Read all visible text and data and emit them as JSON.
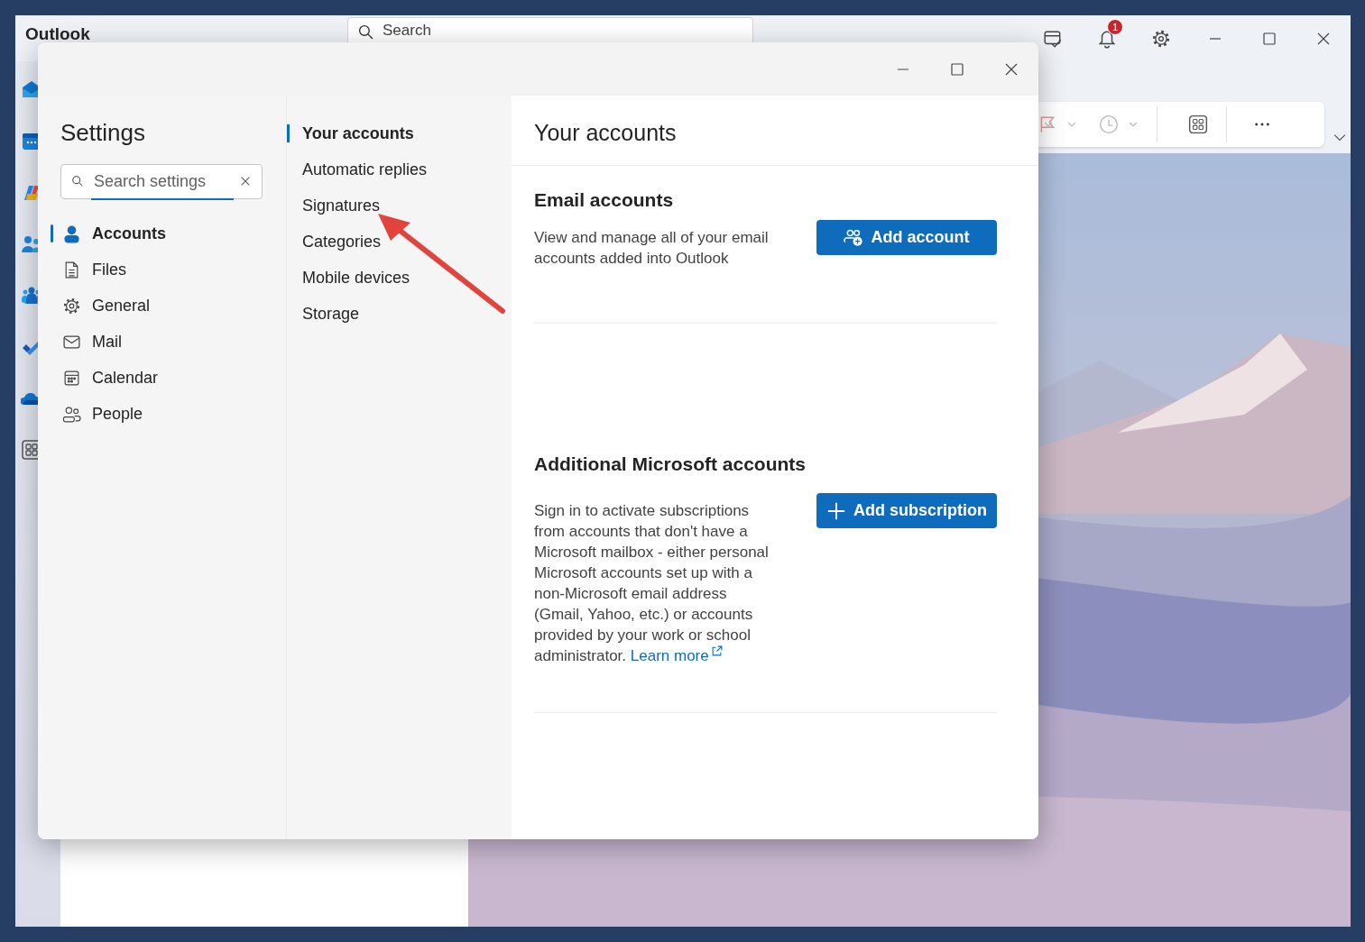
{
  "app": {
    "title": "Outlook",
    "search": {
      "placeholder": "Search"
    },
    "notification_badge": "1"
  },
  "dialog": {
    "title": "Settings",
    "search": {
      "placeholder": "Search settings"
    },
    "categories": [
      {
        "label": "Accounts",
        "kind": "person",
        "selected": true
      },
      {
        "label": "Files",
        "kind": "file",
        "selected": false
      },
      {
        "label": "General",
        "kind": "gear",
        "selected": false
      },
      {
        "label": "Mail",
        "kind": "mail",
        "selected": false
      },
      {
        "label": "Calendar",
        "kind": "calendar",
        "selected": false
      },
      {
        "label": "People",
        "kind": "people",
        "selected": false
      }
    ],
    "subcategories": [
      {
        "label": "Your accounts",
        "selected": true
      },
      {
        "label": "Automatic replies",
        "selected": false
      },
      {
        "label": "Signatures",
        "selected": false
      },
      {
        "label": "Categories",
        "selected": false
      },
      {
        "label": "Mobile devices",
        "selected": false
      },
      {
        "label": "Storage",
        "selected": false
      }
    ],
    "page_title": "Your accounts",
    "sections": [
      {
        "heading": "Email accounts",
        "description": "View and manage all of your email accounts added into Outlook",
        "button": {
          "label": "Add account",
          "kind": "people"
        }
      },
      {
        "heading": "Additional Microsoft accounts",
        "description": "Sign in to activate subscriptions from accounts that don't have a Microsoft mailbox - either personal Microsoft accounts set up with a non-Microsoft email address (Gmail, Yahoo, etc.) or accounts provided by your work or school administrator.",
        "link": "Learn more",
        "button": {
          "label": "Add subscription",
          "kind": "plus"
        }
      }
    ]
  }
}
